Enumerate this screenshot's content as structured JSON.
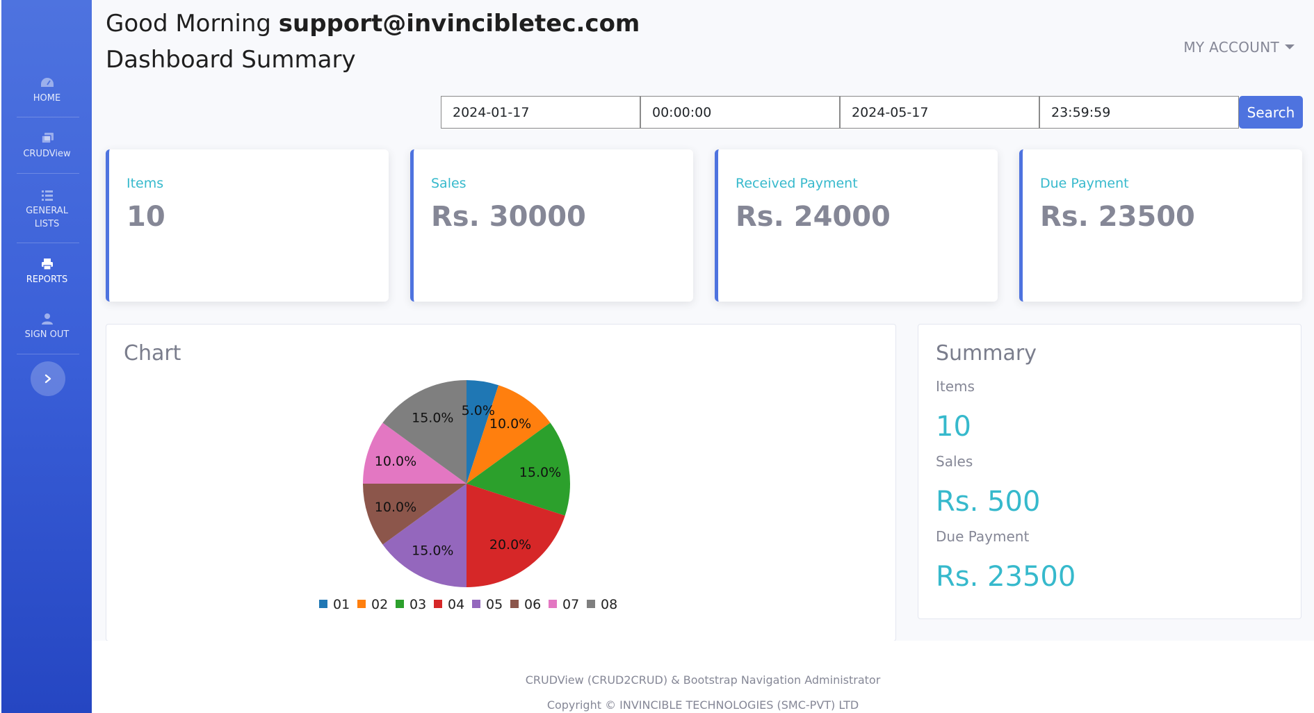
{
  "sidebar": {
    "items": [
      {
        "label": "HOME",
        "icon": "gauge-icon"
      },
      {
        "label": "CRUDView",
        "icon": "copy-icon"
      },
      {
        "label": "GENERAL LISTS",
        "icon": "list-icon"
      },
      {
        "label": "REPORTS",
        "icon": "printer-icon"
      },
      {
        "label": "SIGN OUT",
        "icon": "user-icon"
      }
    ],
    "toggle_icon": "chevron-right-icon"
  },
  "header": {
    "greeting_prefix": "Good Morning",
    "user_email": "support@invincibletec.com",
    "page_title": "Dashboard Summary",
    "account_menu": "MY ACCOUNT"
  },
  "filters": {
    "start_date": "2024-01-17",
    "start_time": "00:00:00",
    "end_date": "2024-05-17",
    "end_time": "23:59:59",
    "search_label": "Search"
  },
  "stats": [
    {
      "title": "Items",
      "value": "10"
    },
    {
      "title": "Sales",
      "value": "Rs. 30000"
    },
    {
      "title": "Received Payment",
      "value": "Rs. 24000"
    },
    {
      "title": "Due Payment",
      "value": "Rs. 23500"
    }
  ],
  "chart_panel": {
    "title": "Chart"
  },
  "chart_data": {
    "type": "pie",
    "categories": [
      "01",
      "02",
      "03",
      "04",
      "05",
      "06",
      "07",
      "08"
    ],
    "values": [
      5.0,
      10.0,
      15.0,
      20.0,
      15.0,
      10.0,
      10.0,
      15.0
    ],
    "labels": [
      "5.0%",
      "20.0%",
      "15.0%",
      "15.0%",
      "15.0%",
      "10.0%",
      "10.0%",
      "10.0%"
    ],
    "colors": [
      "#1f77b4",
      "#ff7f0e",
      "#2ca02c",
      "#d62728",
      "#9467bd",
      "#8c564b",
      "#e377c2",
      "#7f7f7f"
    ],
    "legend_position": "bottom"
  },
  "summary": {
    "title": "Summary",
    "rows": [
      {
        "label": "Items",
        "value": "10"
      },
      {
        "label": "Sales",
        "value": "Rs. 500"
      },
      {
        "label": "Due Payment",
        "value": "Rs. 23500"
      }
    ]
  },
  "footer": {
    "line1": "CRUDView (CRUD2CRUD) & Bootstrap Navigation Administrator",
    "line2": "Copyright © INVINCIBLE TECHNOLOGIES (SMC-PVT) LTD"
  },
  "colors": {
    "primary": "#4e73df",
    "info": "#36b9cc",
    "muted": "#858796"
  }
}
